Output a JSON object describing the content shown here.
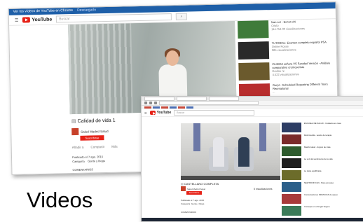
{
  "back_shot": {
    "top_bar": {
      "text": "Ver los vídeos de YouTube en Chrome",
      "link": "Descargarlo"
    },
    "header": {
      "logo_text": "YouTube",
      "search_placeholder": "Buscar"
    },
    "video": {
      "title": "Calidad de vida 1",
      "channel": "Salud Madrid Salud",
      "subscribe": "Suscribirse",
      "actions": [
        "Añadir a",
        "Compartir",
        "Más"
      ],
      "published": "Publicado el 7 ago. 2015",
      "category_label": "Categoría",
      "category_value": "Gente y blogs",
      "comments_label": "COMENTARIOS"
    },
    "sidebar": [
      {
        "title": "Nan cor - Es tan chi",
        "sub": "Cristo",
        "views": "114.754.00 visualizaciones",
        "color": "#3f7b3a"
      },
      {
        "title": "TUTORIAL: Examen completo español PSA",
        "sub": "Online Rosse",
        "views": "985 visualizaciones",
        "color": "#2a2a2a"
      },
      {
        "title": "CLINIDA señora VS Sanidad Versión - Análisis comparativo cromosomas",
        "sub": "Dmitrie nr.",
        "views": "4.522 visualizaciones",
        "color": "#6b5a2d"
      },
      {
        "title": "Gerpt - Scheduled Repeating Different Tours Recreational",
        "sub": "...",
        "views": "",
        "color": "#b82d2d"
      }
    ]
  },
  "front_shot": {
    "header": {
      "logo_text": "YouTube",
      "search_placeholder": "Buscar"
    },
    "video": {
      "title": "CASTELLANO COMPLETA",
      "channel": "Salud Madrid Salud",
      "subscribe": "Suscribirse",
      "views": "5 visualizaciones",
      "published": "Publicado el 7 ago. 2015",
      "category_label": "Categoría",
      "category_value": "Gente y blogs",
      "comments_label": "COMENTARIOS"
    },
    "sidebar": [
      {
        "title": "ESCUELA DE SALUD - Cuidados en casa",
        "color": "#2d3d64"
      },
      {
        "title": "Reforma EE - sesión de terapia",
        "color": "#7a2a2a"
      },
      {
        "title": "Madrid salud - Angulo de vista",
        "color": "#2e5b2e"
      },
      {
        "title": "La voz del sentimiento de la vida",
        "color": "#1e1e1e"
      },
      {
        "title": "La dieta equilibrada",
        "color": "#6c6c2a"
      },
      {
        "title": "NEW BOOK FAN - Paso por paso",
        "color": "#2b5f8a"
      },
      {
        "title": "Conversaciones INFANCIAS de apoyo",
        "color": "#a83b3b"
      },
      {
        "title": "Consejos en el Hogar Seguro",
        "color": "#3b7b59"
      }
    ]
  },
  "caption": "Videos"
}
